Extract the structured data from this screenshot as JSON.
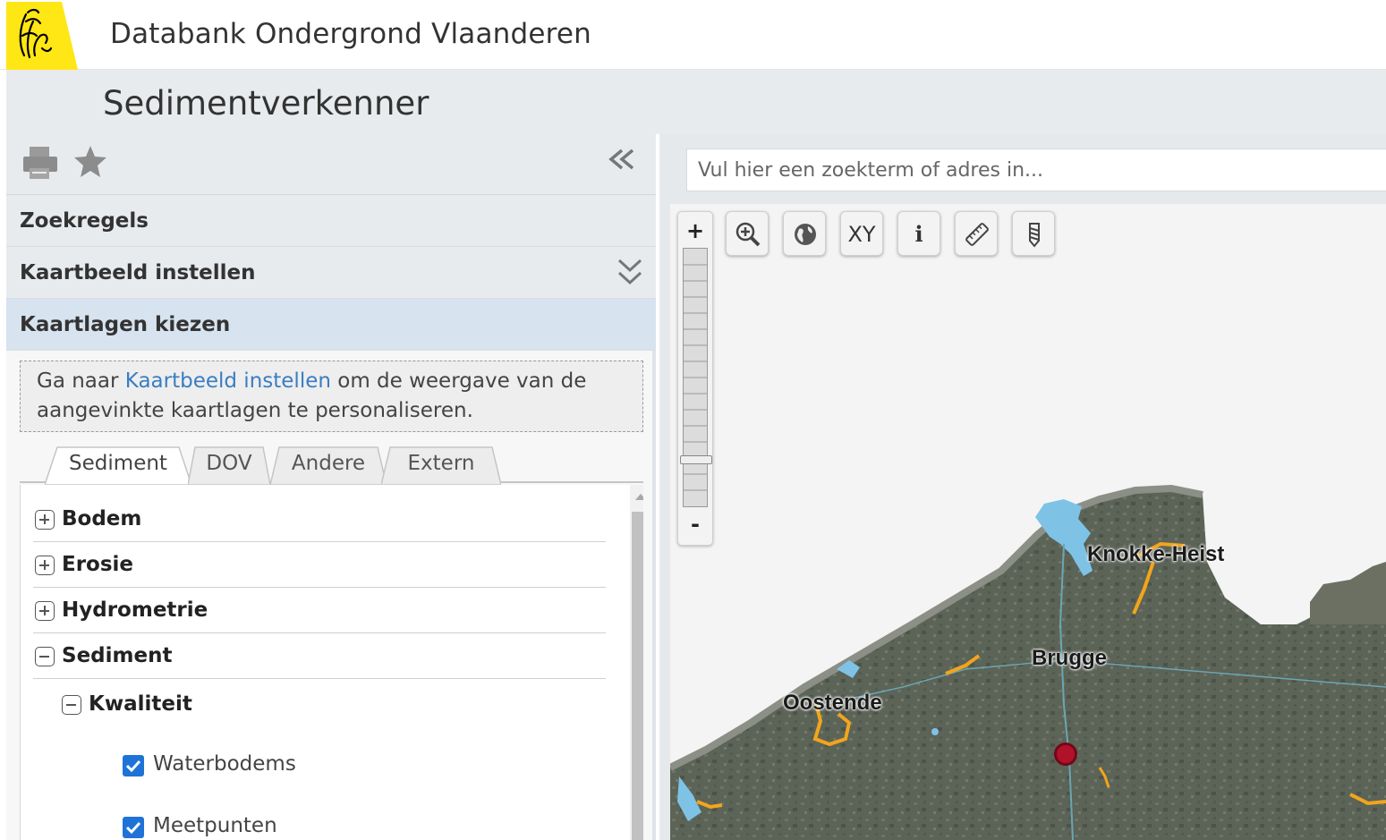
{
  "header": {
    "title": "Databank Ondergrond Vlaanderen",
    "logo": "vlaanderen-lion-logo"
  },
  "app": {
    "title": "Sedimentverkenner"
  },
  "toolbar": {
    "icons": [
      "print-icon",
      "star-icon",
      "double-chevron-left-icon"
    ]
  },
  "sections": [
    {
      "label": "Zoekregels"
    },
    {
      "label": "Kaartbeeld instellen"
    },
    {
      "label": "Kaartlagen kiezen"
    }
  ],
  "info": {
    "prefix": "Ga naar ",
    "link": "Kaartbeeld instellen",
    "suffix": " om de weergave van de aangevinkte kaartlagen te personaliseren."
  },
  "tabs": [
    {
      "label": "Sediment",
      "active": true
    },
    {
      "label": "DOV"
    },
    {
      "label": "Andere"
    },
    {
      "label": "Extern"
    }
  ],
  "tree": {
    "groups": [
      {
        "label": "Bodem",
        "expanded": false
      },
      {
        "label": "Erosie",
        "expanded": false
      },
      {
        "label": "Hydrometrie",
        "expanded": false
      },
      {
        "label": "Sediment",
        "expanded": true
      }
    ],
    "subgroup": {
      "label": "Kwaliteit",
      "expanded": true
    },
    "layers": [
      {
        "label": "Waterbodems",
        "checked": true
      },
      {
        "label": "Meetpunten",
        "checked": true
      }
    ]
  },
  "search": {
    "placeholder": "Vul hier een zoekterm of adres in..."
  },
  "map": {
    "zoom": {
      "plus": "+",
      "minus": "-"
    },
    "tools": [
      {
        "name": "zoom-box-icon"
      },
      {
        "name": "globe-icon"
      },
      {
        "name": "xy-coordinates",
        "label": "XY"
      },
      {
        "name": "info-icon",
        "label": "i"
      },
      {
        "name": "measure-ruler-icon"
      },
      {
        "name": "drill-core-icon"
      }
    ],
    "cities": {
      "knokke": "Knokke-Heist",
      "brugge": "Brugge",
      "oostende": "Oostende"
    },
    "colors": {
      "land": "#5c6357",
      "water": "#7ec3e6",
      "sediment_lines": "#f2a51b",
      "marker": "#b0122a"
    }
  }
}
